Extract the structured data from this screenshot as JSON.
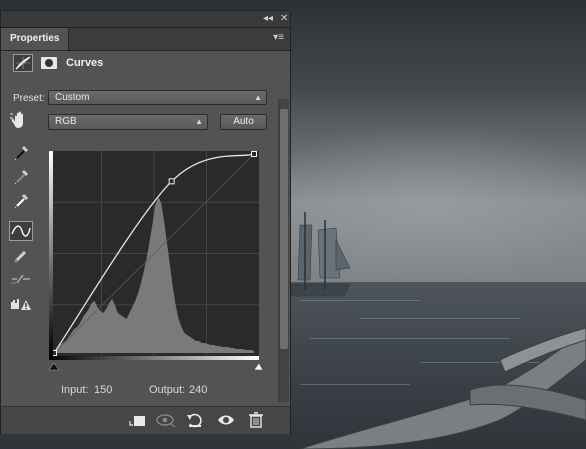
{
  "window": {
    "collapse_glyph": "◂◂",
    "close_glyph": "✕"
  },
  "tabs": [
    {
      "label": "Properties"
    }
  ],
  "panel_menu_glyph": "▾≡",
  "header": {
    "title": "Curves",
    "icons": [
      "curves-adjustment-icon",
      "mask-icon"
    ]
  },
  "preset": {
    "label": "Preset:",
    "value": "Custom"
  },
  "channel": {
    "value": "RGB",
    "auto_label": "Auto"
  },
  "tools": [
    "target-adjust-hand-icon",
    "sample-black-point-eyedropper-icon",
    "sample-gray-point-eyedropper-icon",
    "sample-white-point-eyedropper-icon",
    "edit-points-curve-icon",
    "draw-pencil-icon",
    "smooth-curve-icon",
    "clipping-warning-icon"
  ],
  "io": {
    "input_label": "Input:",
    "input_value": "150",
    "output_label": "Output:",
    "output_value": "240"
  },
  "curve": {
    "range": [
      0,
      255
    ],
    "points": [
      [
        0,
        0
      ],
      [
        150,
        220
      ],
      [
        255,
        255
      ]
    ]
  },
  "bottom_icons": [
    "clip-to-layer-icon",
    "view-previous-state-icon",
    "reset-icon",
    "visibility-eye-icon",
    "delete-trash-icon"
  ]
}
